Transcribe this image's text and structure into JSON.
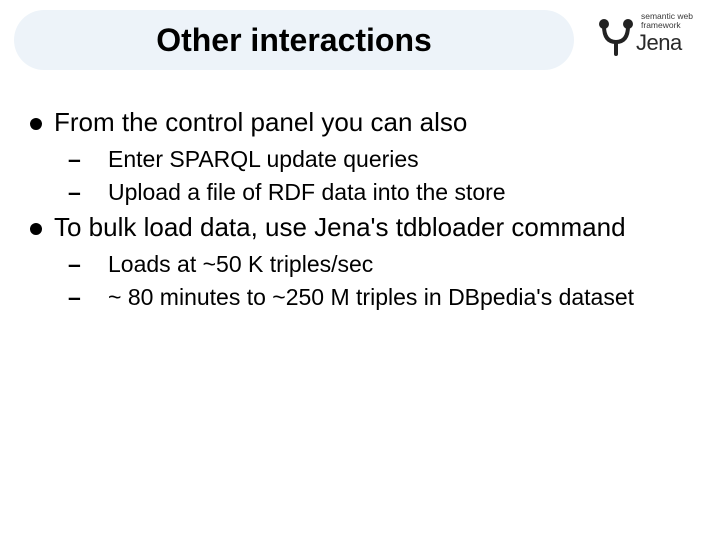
{
  "header": {
    "title": "Other interactions"
  },
  "logo": {
    "tagline": "semantic web\nframework",
    "name": "Jena"
  },
  "bullets": [
    {
      "text": "From the control panel you can also",
      "sub": [
        "Enter SPARQL update queries",
        "Upload a file of RDF data into the store"
      ]
    },
    {
      "text": "To bulk load data, use Jena's tdbloader command",
      "sub": [
        "Loads at ~50 K triples/sec",
        "~ 80 minutes to ~250 M triples in DBpedia's dataset"
      ]
    }
  ]
}
